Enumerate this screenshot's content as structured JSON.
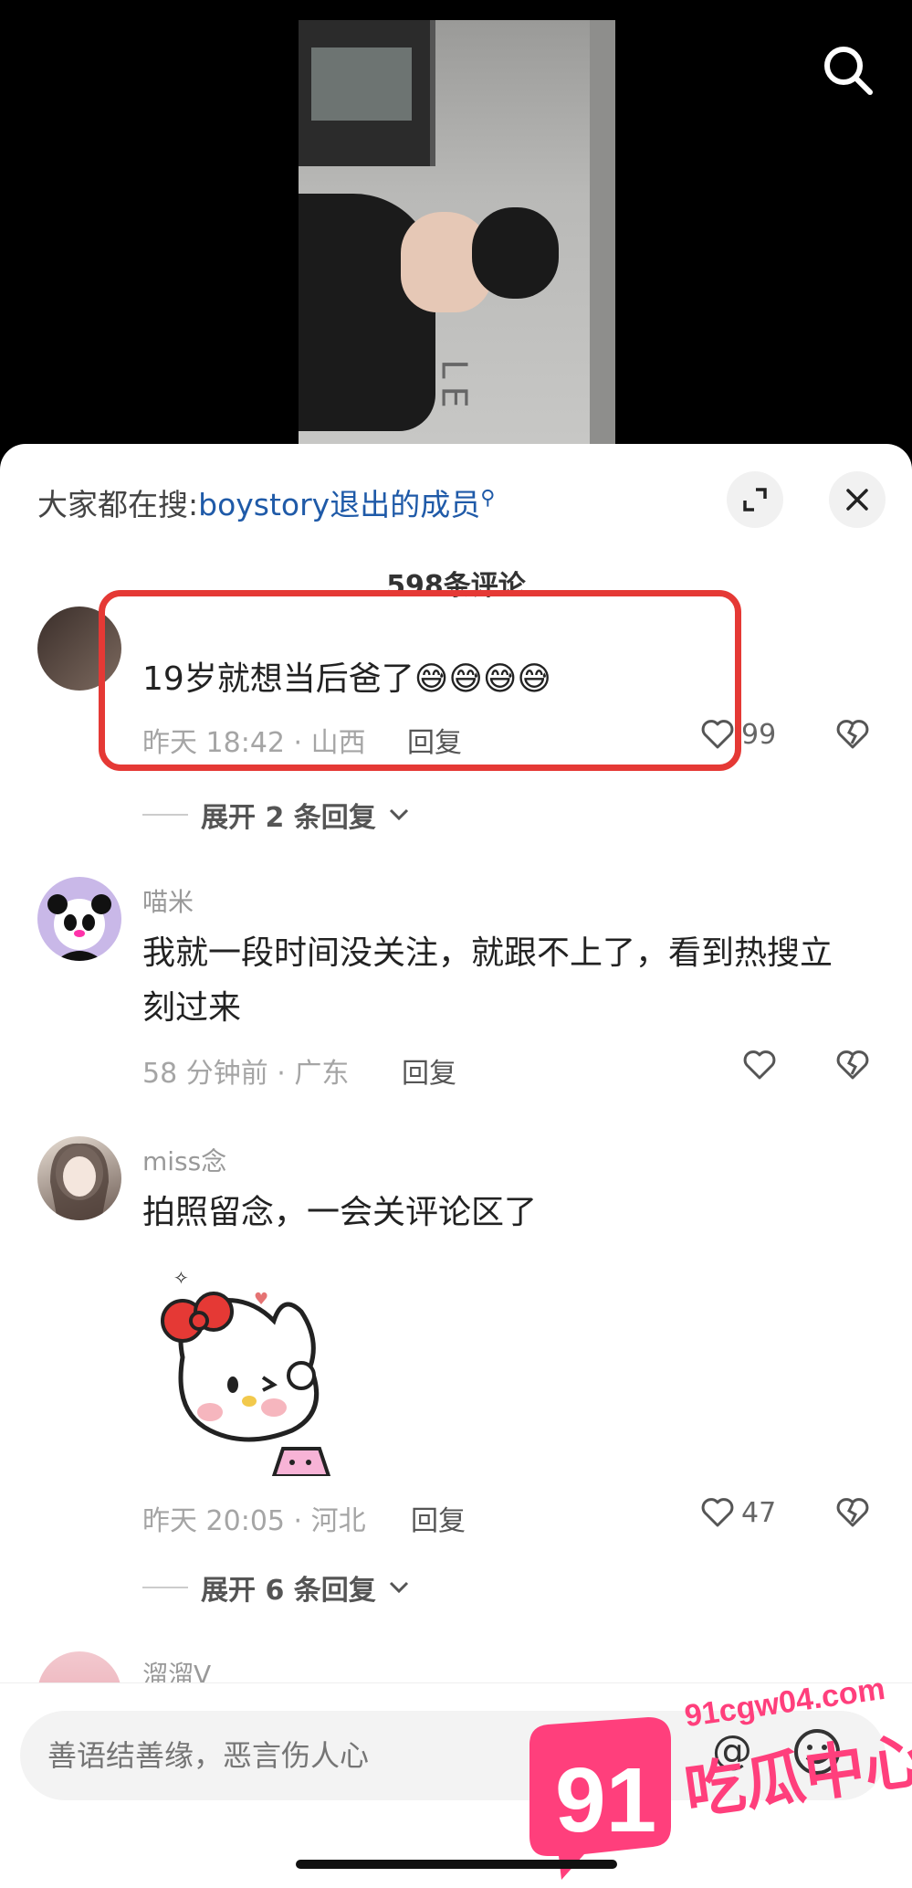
{
  "hot_search": {
    "prefix": "大家都在搜:",
    "term": "boystory退出的成员"
  },
  "comment_count": "598条评论",
  "comments": [
    {
      "username": "",
      "text": "19岁就想当后爸了😅😅😅😅",
      "time_location": "昨天 18:42 · 山西",
      "reply_label": "回复",
      "likes": "99",
      "expand_label": "展开 2 条回复"
    },
    {
      "username": "喵米",
      "text": "我就一段时间没关注，就跟不上了，看到热搜立刻过来",
      "time_location": "58 分钟前 · 广东",
      "reply_label": "回复",
      "likes": ""
    },
    {
      "username": "miss念",
      "text": "拍照留念，一会关评论区了",
      "time_location": "昨天 20:05 · 河北",
      "reply_label": "回复",
      "likes": "47",
      "expand_label": "展开 6 条回复"
    },
    {
      "username": "溜溜V"
    }
  ],
  "input": {
    "placeholder": "善语结善缘，恶言伤人心"
  },
  "icons": {
    "search": "search-icon",
    "expand": "expand-icon",
    "close": "close-icon",
    "like": "heart-icon",
    "dislike": "broken-heart-icon",
    "image": "image-icon",
    "mention": "at-icon",
    "emoji": "emoji-icon"
  },
  "watermark": {
    "number": "91",
    "domain": "91cgw04.com",
    "name": "吃瓜中心"
  },
  "colors": {
    "link": "#1f5aa8",
    "highlight": "#e53935",
    "watermark": "#ff3f7c"
  }
}
